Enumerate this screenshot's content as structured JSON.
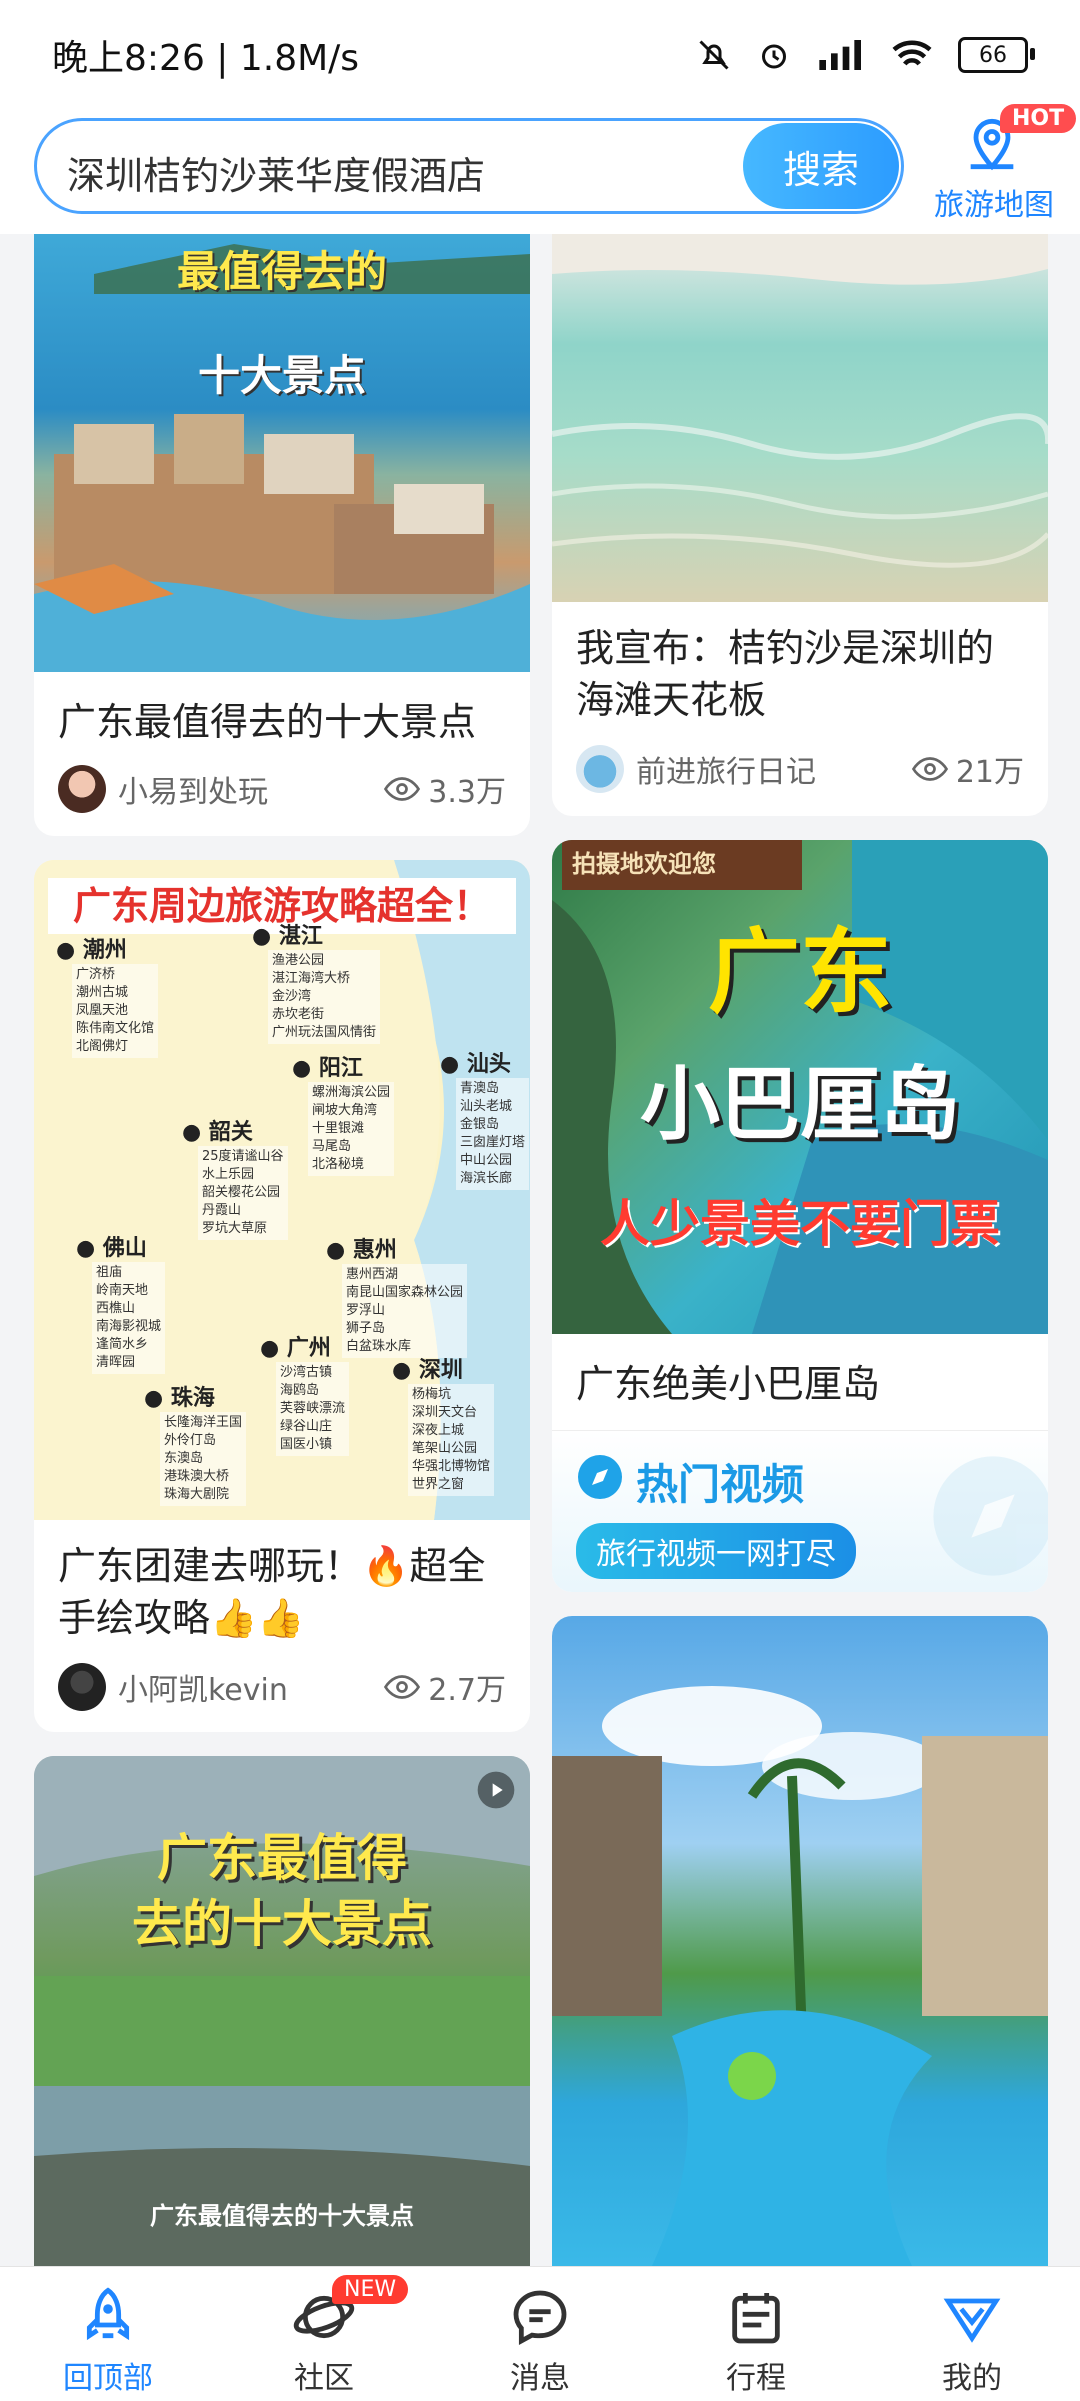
{
  "status": {
    "time": "晚上8:26 | 1.8M/s",
    "battery": "66"
  },
  "header": {
    "search_text": "深圳桔钓沙莱华度假酒店",
    "search_button": "搜索",
    "map_label": "旅游地图",
    "map_badge": "HOT"
  },
  "cards": {
    "c1": {
      "overlay_top": "最值得去的",
      "overlay_bottom": "十大景点",
      "title": "广东最值得去的十大景点",
      "author": "小易到处玩",
      "views": "3.3万"
    },
    "c2": {
      "title": "我宣布：桔钓沙是深圳的海滩天花板",
      "author": "前进旅行日记",
      "views": "21万"
    },
    "c3": {
      "overlay_title": "广东周边旅游攻略超全！",
      "cities": [
        {
          "name": "潮州",
          "spots": "广济桥\n潮州古城\n凤凰天池\n陈伟南文化馆\n北阁佛灯"
        },
        {
          "name": "湛江",
          "spots": "渔港公园\n湛江海湾大桥\n金沙湾\n赤坎老街\n广州玩法国风情街"
        },
        {
          "name": "汕头",
          "spots": "青澳岛\n汕头老城\n金银岛\n三囱崖灯塔\n中山公园\n海滨长廊"
        },
        {
          "name": "阳江",
          "spots": "螺洲海滨公园\n闸坡大角湾\n十里银滩\n马尾岛\n北洛秘境"
        },
        {
          "name": "韶关",
          "spots": "25度请谧山谷\n水上乐园\n韶关樱花公园\n丹霞山\n罗坑大草原"
        },
        {
          "name": "佛山",
          "spots": "祖庙\n岭南天地\n西樵山\n南海影视城\n逢简水乡\n清晖园"
        },
        {
          "name": "惠州",
          "spots": "惠州西湖\n南昆山国家森林公园\n罗浮山\n狮子岛\n白盆珠水库"
        },
        {
          "name": "广州",
          "spots": "沙湾古镇\n海鸥岛\n芙蓉峡漂流\n绿谷山庄\n国医小镇"
        },
        {
          "name": "深圳",
          "spots": "杨梅坑\n深圳天文台\n深夜上城\n笔架山公园\n华强北博物馆\n世界之窗"
        },
        {
          "name": "珠海",
          "spots": "长隆海洋王国\n外伶仃岛\n东澳岛\n港珠澳大桥\n珠海大剧院"
        }
      ],
      "title": "广东团建去哪玩！🔥超全手绘攻略👍👍",
      "author": "小阿凯kevin",
      "views": "2.7万"
    },
    "c4": {
      "overlay_top": "广东",
      "overlay_mid": "小巴厘岛",
      "overlay_bottom": "人少景美不要门票",
      "signboard": "拍摄地欢迎您",
      "title": "广东绝美小巴厘岛",
      "hot_video_title": "热门视频",
      "hot_video_tag": "旅行视频一网打尽"
    },
    "c5": {
      "overlay_title_1": "广东最值得",
      "overlay_title_2": "去的十大景点",
      "overlay_caption": "广东最值得去的十大景点"
    }
  },
  "nav": {
    "items": [
      {
        "label": "回顶部",
        "icon": "rocket-icon"
      },
      {
        "label": "社区",
        "icon": "planet-icon"
      },
      {
        "label": "消息",
        "icon": "message-icon"
      },
      {
        "label": "行程",
        "icon": "calendar-icon"
      },
      {
        "label": "我的",
        "icon": "profile-icon"
      }
    ],
    "new_badge": "NEW"
  },
  "colors": {
    "accent": "#2c9cff",
    "hot": "#ff4d4f",
    "nav_active": "#1f86ff"
  }
}
